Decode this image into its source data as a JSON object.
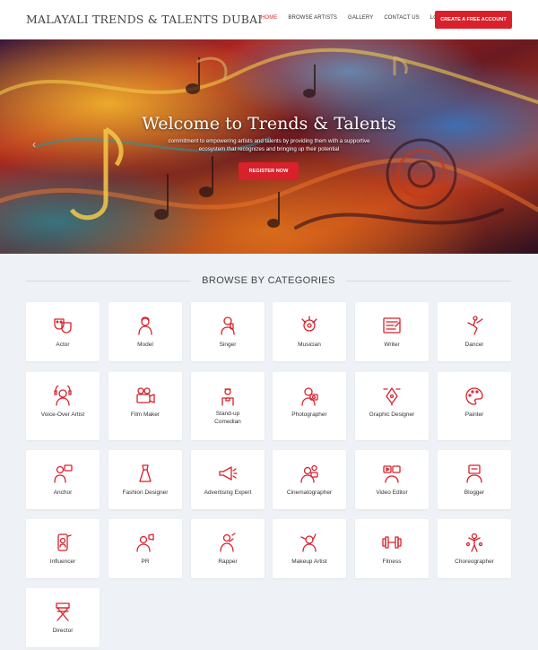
{
  "header": {
    "brand": "MALAYALI TRENDS & TALENTS DUBAI",
    "nav": [
      {
        "label": "HOME",
        "active": true
      },
      {
        "label": "BROWSE ARTISTS",
        "active": false
      },
      {
        "label": "GALLERY",
        "active": false
      },
      {
        "label": "CONTACT US",
        "active": false
      },
      {
        "label": "LOGIN",
        "active": false
      }
    ],
    "cta_label": "CREATE A FREE ACCOUNT"
  },
  "hero": {
    "title": "Welcome to Trends & Talents",
    "subtitle": "commitment to empowering artists and talents by providing them with a supportive ecosystem that recognizes and bringing up their potential",
    "button_label": "REGISTER NOW"
  },
  "categories": {
    "title": "BROWSE BY CATEGORIES",
    "items": [
      {
        "label": "Actor",
        "icon": "theater-masks-icon"
      },
      {
        "label": "Model",
        "icon": "model-icon"
      },
      {
        "label": "Singer",
        "icon": "singer-icon"
      },
      {
        "label": "Musician",
        "icon": "musician-icon"
      },
      {
        "label": "Writer",
        "icon": "writer-icon"
      },
      {
        "label": "Dancer",
        "icon": "dancer-icon"
      },
      {
        "label": "Voice-Over Artist",
        "icon": "voice-over-icon"
      },
      {
        "label": "Film Maker",
        "icon": "film-camera-icon"
      },
      {
        "label": "Stand-up Comedian",
        "icon": "comedian-icon"
      },
      {
        "label": "Photographer",
        "icon": "photographer-icon"
      },
      {
        "label": "Graphic Designer",
        "icon": "pen-tool-icon"
      },
      {
        "label": "Painter",
        "icon": "palette-icon"
      },
      {
        "label": "Anchor",
        "icon": "anchor-presenter-icon"
      },
      {
        "label": "Fashion Designer",
        "icon": "dress-icon"
      },
      {
        "label": "Advertising Expert",
        "icon": "megaphone-icon"
      },
      {
        "label": "Cinematographer",
        "icon": "cinematographer-icon"
      },
      {
        "label": "Video Editor",
        "icon": "video-editor-icon"
      },
      {
        "label": "Blogger",
        "icon": "blogger-icon"
      },
      {
        "label": "Influencer",
        "icon": "influencer-icon"
      },
      {
        "label": "PR",
        "icon": "pr-icon"
      },
      {
        "label": "Rapper",
        "icon": "rapper-icon"
      },
      {
        "label": "Makeup Artist",
        "icon": "makeup-icon"
      },
      {
        "label": "Fitness",
        "icon": "dumbbell-icon"
      },
      {
        "label": "Choreographer",
        "icon": "choreographer-icon"
      },
      {
        "label": "Director",
        "icon": "director-chair-icon"
      }
    ]
  },
  "colors": {
    "accent": "#d8212b",
    "page_bg": "#eef1f5",
    "icon": "#d8212b"
  }
}
